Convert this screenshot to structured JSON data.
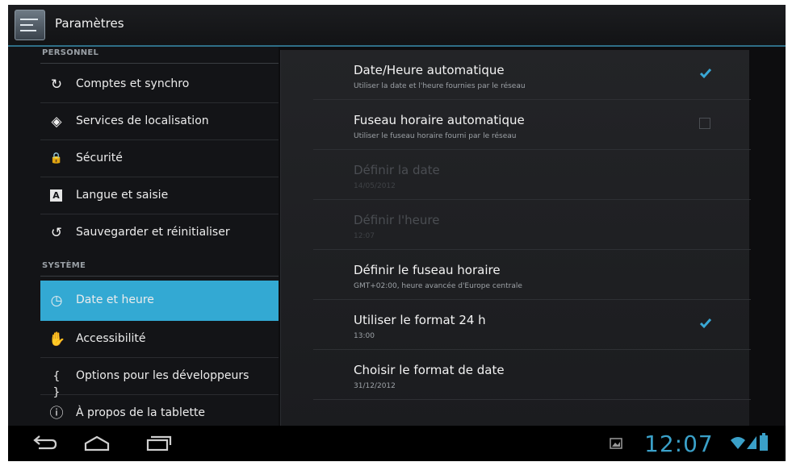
{
  "app": {
    "title": "Paramètres",
    "icon": "settings-app-icon"
  },
  "sidebar": {
    "section_personal": "PERSONNEL",
    "section_system": "SYSTÈME",
    "items": [
      {
        "label": "Comptes et synchro",
        "icon": "sync-icon",
        "glyph": "↻"
      },
      {
        "label": "Services de localisation",
        "icon": "location-icon",
        "glyph": "◈"
      },
      {
        "label": "Sécurité",
        "icon": "lock-icon",
        "glyph": "🔒"
      },
      {
        "label": "Langue et saisie",
        "icon": "keyboard-letter-icon",
        "glyph": "A"
      },
      {
        "label": "Sauvegarder et réinitialiser",
        "icon": "backup-icon",
        "glyph": "↺"
      },
      {
        "label": "Date et heure",
        "icon": "clock-icon",
        "glyph": "◷",
        "selected": true
      },
      {
        "label": "Accessibilité",
        "icon": "hand-icon",
        "glyph": "✋"
      },
      {
        "label": "Options pour les développeurs",
        "icon": "braces-icon",
        "glyph": "{ }"
      },
      {
        "label": "À propos de la tablette",
        "icon": "info-icon",
        "glyph": "ⓘ"
      }
    ]
  },
  "detail": {
    "prefs": [
      {
        "title": "Date/Heure automatique",
        "summary": "Utiliser la date et l'heure fournies par le réseau",
        "checkbox": true,
        "checked": true
      },
      {
        "title": "Fuseau horaire automatique",
        "summary": "Utiliser le fuseau horaire fourni par le réseau",
        "checkbox": true,
        "checked": false
      },
      {
        "title": "Définir la date",
        "summary": "14/05/2012",
        "disabled": true
      },
      {
        "title": "Définir l'heure",
        "summary": "12:07",
        "disabled": true
      },
      {
        "title": "Définir le fuseau horaire",
        "summary": "GMT+02:00, heure avancée d'Europe centrale"
      },
      {
        "title": "Utiliser le format 24 h",
        "summary": "13:00",
        "checkbox": true,
        "checked": true
      },
      {
        "title": "Choisir le format de date",
        "summary": "31/12/2012"
      }
    ]
  },
  "navbar": {
    "back": "back-icon",
    "home": "home-icon",
    "recents": "recent-apps-icon",
    "clock": "12:07",
    "status_icons": [
      "gallery-notification-icon",
      "wifi-icon",
      "signal-icon",
      "battery-icon"
    ]
  },
  "colors": {
    "accent": "#33a9d3",
    "clock": "#3aa0c8"
  }
}
